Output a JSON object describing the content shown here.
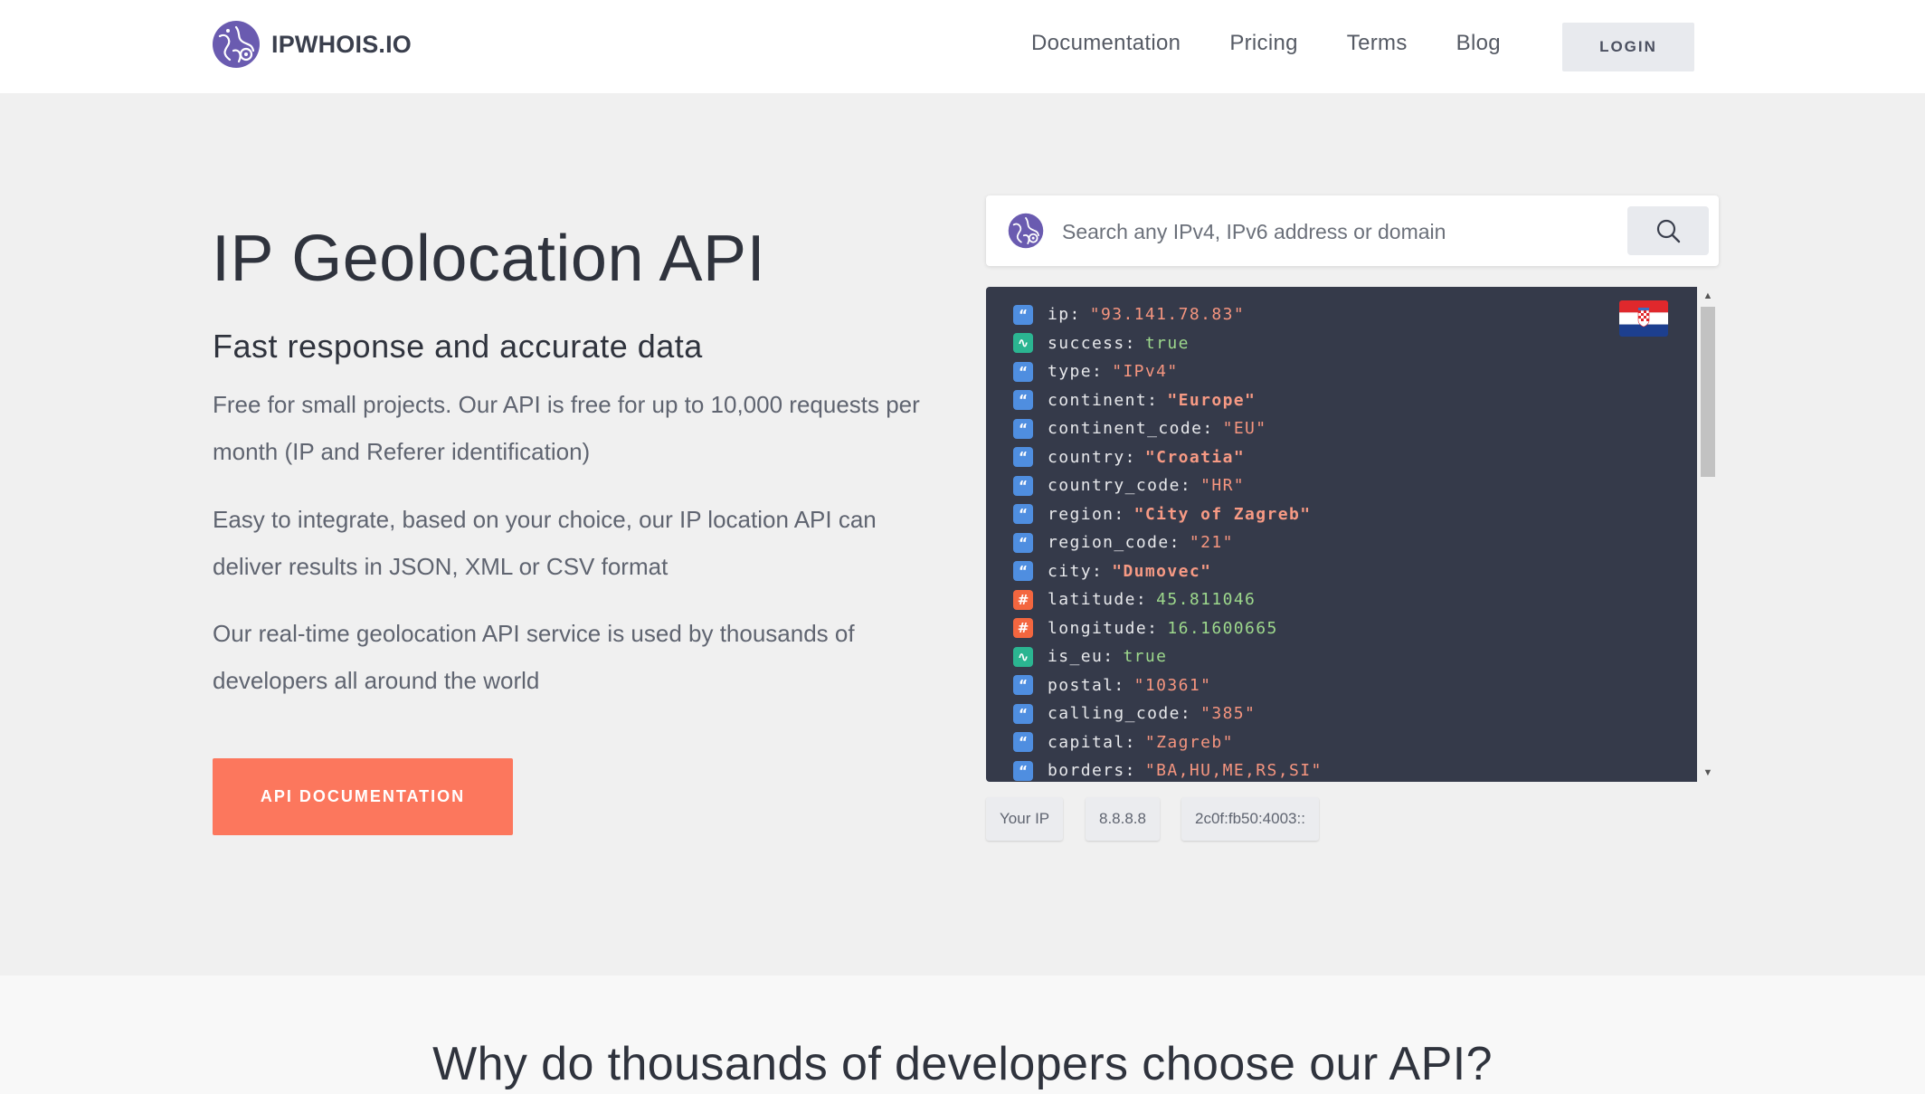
{
  "header": {
    "logo_text": "IPWHOIS.IO",
    "nav": [
      {
        "label": "Documentation"
      },
      {
        "label": "Pricing"
      },
      {
        "label": "Terms"
      },
      {
        "label": "Blog"
      }
    ],
    "login_label": "LOGIN"
  },
  "hero": {
    "title": "IP Geolocation API",
    "subtitle": "Fast response and accurate data",
    "paragraphs": [
      "Free for small projects. Our API is free for up to 10,000 requests per month (IP and Referer identification)",
      "Easy to integrate, based on your choice, our IP location API can deliver results in JSON, XML or CSV format",
      "Our real-time geolocation API service is used by thousands of developers all around the world"
    ],
    "cta_label": "API DOCUMENTATION"
  },
  "search": {
    "placeholder": "Search any IPv4, IPv6 address or domain",
    "value": ""
  },
  "result": {
    "flag_country": "Croatia",
    "rows": [
      {
        "type_icon": "quote-icon",
        "key": "ip",
        "value": "\"93.141.78.83\""
      },
      {
        "type_icon": "boolean-icon",
        "key": "success",
        "value": "true"
      },
      {
        "type_icon": "quote-icon",
        "key": "type",
        "value": "\"IPv4\""
      },
      {
        "type_icon": "quote-icon",
        "key": "continent",
        "value": "\"Europe\""
      },
      {
        "type_icon": "quote-icon",
        "key": "continent_code",
        "value": "\"EU\""
      },
      {
        "type_icon": "quote-icon",
        "key": "country",
        "value": "\"Croatia\""
      },
      {
        "type_icon": "quote-icon",
        "key": "country_code",
        "value": "\"HR\""
      },
      {
        "type_icon": "quote-icon",
        "key": "region",
        "value": "\"City of Zagreb\""
      },
      {
        "type_icon": "quote-icon",
        "key": "region_code",
        "value": "\"21\""
      },
      {
        "type_icon": "quote-icon",
        "key": "city",
        "value": "\"Dumovec\""
      },
      {
        "type_icon": "hash-icon",
        "key": "latitude",
        "value": "45.811046"
      },
      {
        "type_icon": "hash-icon",
        "key": "longitude",
        "value": "16.1600665"
      },
      {
        "type_icon": "boolean-icon",
        "key": "is_eu",
        "value": "true"
      },
      {
        "type_icon": "quote-icon",
        "key": "postal",
        "value": "\"10361\""
      },
      {
        "type_icon": "quote-icon",
        "key": "calling_code",
        "value": "\"385\""
      },
      {
        "type_icon": "quote-icon",
        "key": "capital",
        "value": "\"Zagreb\""
      },
      {
        "type_icon": "quote-icon",
        "key": "borders",
        "value": "\"BA,HU,ME,RS,SI\""
      }
    ]
  },
  "quick_ips": [
    {
      "label": "Your IP"
    },
    {
      "label": "8.8.8.8"
    },
    {
      "label": "2c0f:fb50:4003::"
    }
  ],
  "why_section": {
    "title": "Why do thousands of developers choose our API?"
  },
  "colors": {
    "accent": "#fc775d",
    "json_background": "#353a4a",
    "string_icon": "#4f8ee0",
    "boolean_icon": "#2bb591",
    "number_icon": "#f3663f"
  }
}
